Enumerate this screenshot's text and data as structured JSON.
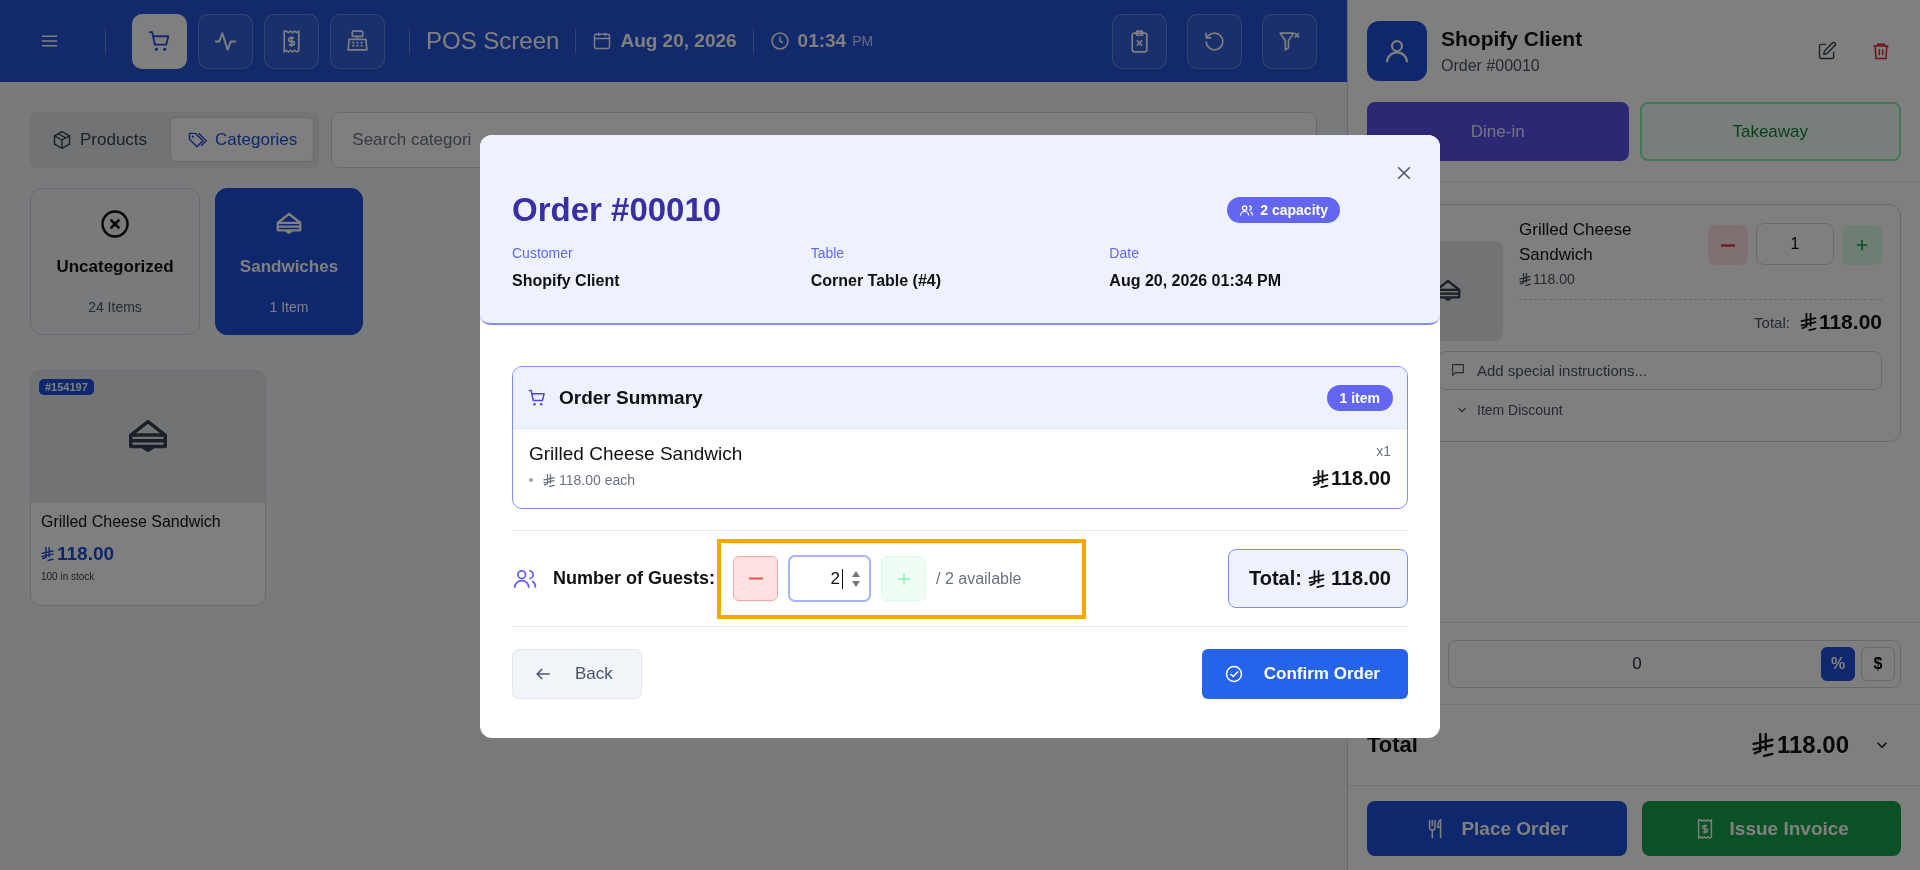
{
  "header": {
    "nav_buttons": [
      {
        "kind": "cart",
        "selected": true
      },
      {
        "kind": "activity",
        "selected": false
      },
      {
        "kind": "receipt",
        "selected": false
      },
      {
        "kind": "register",
        "selected": false
      }
    ],
    "title": "POS Screen",
    "date": "Aug 20, 2026",
    "time": "01:34",
    "meridiem": "PM",
    "actions": [
      {
        "kind": "clipboard-x"
      },
      {
        "kind": "refresh"
      },
      {
        "kind": "filter-x"
      }
    ]
  },
  "view_tabs": [
    {
      "label": "Products",
      "kind": "box",
      "selected": false
    },
    {
      "label": "Categories",
      "kind": "tags",
      "selected": true
    }
  ],
  "search": {
    "placeholder": "Search categori"
  },
  "categories": [
    {
      "name": "Uncategorized",
      "count": "24 Items",
      "kind": "none",
      "selected": false
    },
    {
      "name": "Sandwiches",
      "count": "1 Item",
      "kind": "sandwich",
      "selected": true
    }
  ],
  "products": [
    {
      "badge": "#154197",
      "name": "Grilled Cheese Sandwich",
      "price": "118.00",
      "stock": "100 in stock"
    }
  ],
  "cart": {
    "customer": "Shopify Client",
    "order_number": "Order #00010",
    "order_types": [
      {
        "label": "Dine-in",
        "selected": true
      },
      {
        "label": "Takeaway",
        "selected": false
      }
    ],
    "items": [
      {
        "name": "Grilled Cheese Sandwich",
        "price": "118.00",
        "quantity": "1",
        "total_label": "Total:",
        "total": "118.00",
        "instructions_placeholder": "Add special instructions...",
        "discount_label": "Item Discount"
      }
    ],
    "discount": {
      "value": "0",
      "modes": [
        {
          "label": "%",
          "selected": true
        },
        {
          "label": "$",
          "selected": false
        }
      ]
    },
    "total_label": "Total",
    "total": "118.00",
    "actions": [
      {
        "label": "Place Order",
        "kind": "place"
      },
      {
        "label": "Issue Invoice",
        "kind": "invoice"
      }
    ]
  },
  "modal": {
    "title": "Order #00010",
    "capacity": "2 capacity",
    "details": [
      {
        "label": "Customer",
        "value": "Shopify Client"
      },
      {
        "label": "Table",
        "value": "Corner Table (#4)"
      },
      {
        "label": "Date",
        "value": "Aug 20, 2026 01:34 PM"
      }
    ],
    "summary": {
      "title": "Order Summary",
      "count": "1 item",
      "items": [
        {
          "name": "Grilled Cheese Sandwich",
          "unit": "118.00 each",
          "quantity": "x1",
          "total": "118.00"
        }
      ]
    },
    "guests": {
      "label": "Number of Guests:",
      "value": "2",
      "available": "/ 2 available"
    },
    "total_label": "Total:",
    "total": "118.00",
    "back": "Back",
    "confirm": "Confirm Order"
  }
}
